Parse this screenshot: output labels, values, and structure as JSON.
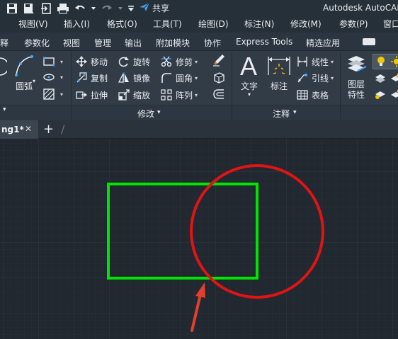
{
  "title_bar": {
    "quick_access_icons": [
      "save-icon",
      "save-as-icon",
      "import-icon",
      "print-icon",
      "undo-icon",
      "redo-icon",
      "customize-icon"
    ],
    "share_label": "共享",
    "app_title": "Autodesk AutoCAD"
  },
  "menu": {
    "items": [
      "视图(V)",
      "插入(I)",
      "格式(O)",
      "工具(T)",
      "绘图(D)",
      "标注(N)",
      "修改(M)",
      "参数(P)",
      "窗口"
    ]
  },
  "ribbon_tabs": {
    "items": [
      "释",
      "参数化",
      "视图",
      "管理",
      "输出",
      "附加模块",
      "协作",
      "Express Tools",
      "精选应用"
    ]
  },
  "ribbon": {
    "draw": {
      "arc_label": "圆弧"
    },
    "modify": {
      "panel_label": "修改",
      "commands": {
        "move": "移动",
        "rotate": "旋转",
        "trim": "修剪",
        "copy": "复制",
        "mirror": "镜像",
        "fillet": "圆角",
        "stretch": "拉伸",
        "scale": "缩放",
        "array": "阵列"
      }
    },
    "annotation": {
      "panel_label": "注释",
      "text_label": "文字",
      "dimension_label": "标注",
      "linear_label": "线性",
      "leader_label": "引线",
      "table_label": "表格"
    },
    "layers": {
      "properties_line1": "图层",
      "properties_line2": "特性"
    }
  },
  "document": {
    "tab_name": "ng1*",
    "close_glyph": "✕",
    "new_tab_glyph": "+"
  },
  "colors": {
    "menubar": "#263039",
    "ribbon": "#323c47",
    "canvas": "#212830",
    "rectangle": "#00e400",
    "circle": "#e01414",
    "arrow": "#e0402f"
  }
}
